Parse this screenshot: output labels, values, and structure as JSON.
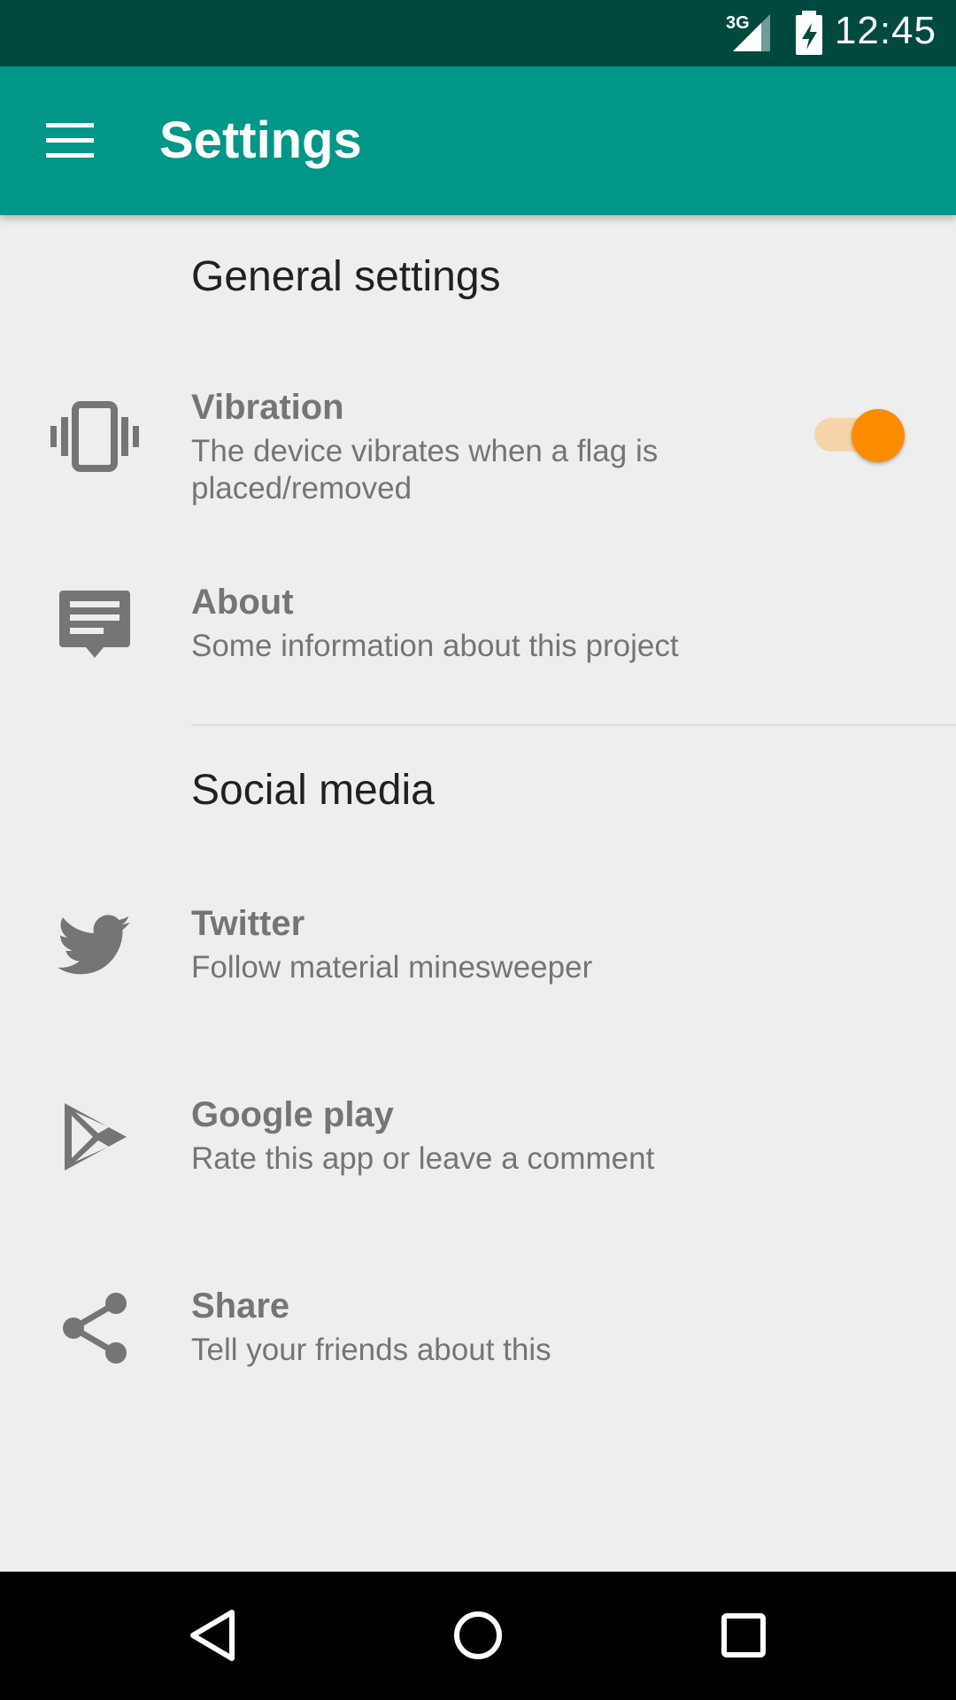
{
  "status_bar": {
    "network": "3G",
    "time": "12:45"
  },
  "app_bar": {
    "title": "Settings"
  },
  "sections": [
    {
      "header": "General settings",
      "items": [
        {
          "title": "Vibration",
          "summary": "The device vibrates when a flag is placed/removed",
          "icon": "vibration-icon",
          "switch_on": true
        },
        {
          "title": "About",
          "summary": "Some information about this project",
          "icon": "about-comment-icon"
        }
      ]
    },
    {
      "header": "Social media",
      "items": [
        {
          "title": "Twitter",
          "summary": "Follow material minesweeper",
          "icon": "twitter-icon"
        },
        {
          "title": "Google play",
          "summary": "Rate this app or leave a comment",
          "icon": "google-play-icon"
        },
        {
          "title": "Share",
          "summary": "Tell your friends about this",
          "icon": "share-icon"
        }
      ]
    }
  ],
  "colors": {
    "status_bar": "#00493f",
    "app_bar": "#009688",
    "accent": "#fb8c00",
    "background": "#eeeeee"
  }
}
